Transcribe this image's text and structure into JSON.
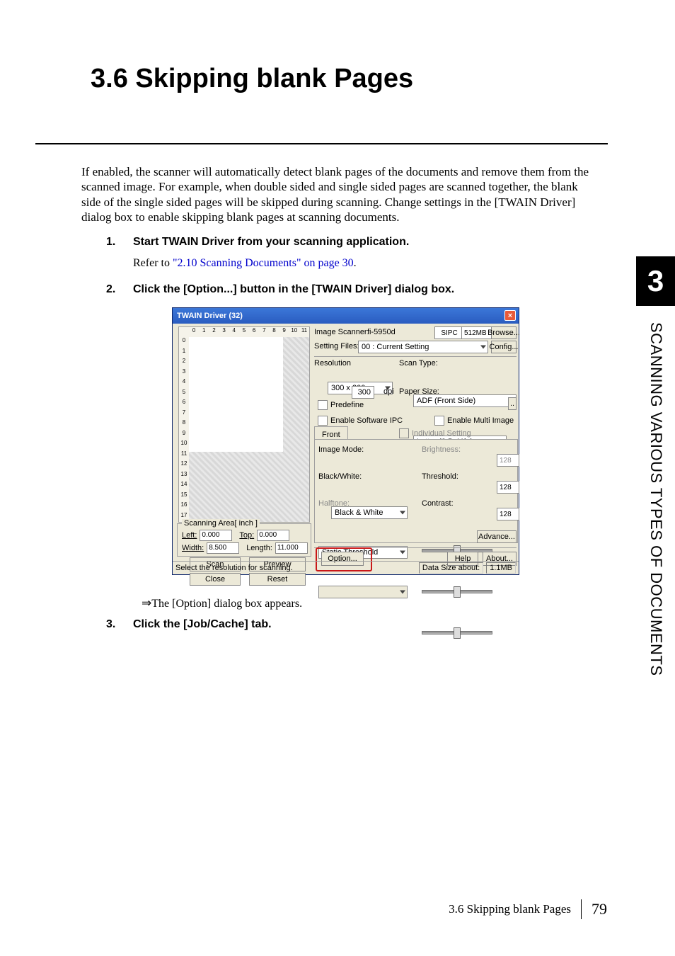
{
  "heading": "3.6  Skipping blank Pages",
  "intro": "If enabled, the scanner will automatically detect blank pages of the documents and remove them from the scanned image. For example, when double sided and single sided pages are scanned together, the blank side of the single sided pages will be skipped during scanning. Change settings in the [TWAIN Driver] dialog box to enable skipping blank pages at scanning documents.",
  "side": {
    "chapter": "3",
    "text": "SCANNING VARIOUS TYPES OF DOCUMENTS"
  },
  "steps": {
    "s1": {
      "num": "1.",
      "text": "Start TWAIN Driver from your scanning application."
    },
    "s2": {
      "num": "2.",
      "text": "Click the [Option...] button in the [TWAIN Driver] dialog box."
    },
    "s3": {
      "num": "3.",
      "text": "Click the [Job/Cache] tab."
    }
  },
  "refer": {
    "prefix": "Refer to ",
    "link": "\"2.10 Scanning Documents\" on page 30",
    "suffix": "."
  },
  "arrow_line": "The [Option] dialog box appears.",
  "dialog": {
    "title": "TWAIN Driver (32)",
    "top": {
      "scanner_lbl": "Image Scanner:",
      "scanner_val": "fi-5950d",
      "sipc": "SIPC",
      "mem": "512MB",
      "browse": "Browse...",
      "setting_lbl": "Setting Files:",
      "setting_val": "00 : Current Setting",
      "config": "Config..."
    },
    "res": {
      "label": "Resolution",
      "value": "300 x 300",
      "dpi_val": "300",
      "dpi_unit": "dpi",
      "predefine": "Predefine"
    },
    "scantype": {
      "label": "Scan Type:",
      "value": "ADF (Front Side)"
    },
    "papersize": {
      "label": "Paper Size:",
      "value": "Letter (8.5x11in)"
    },
    "cb": {
      "softipc": "Enable Software IPC",
      "multi": "Enable Multi Image",
      "indiv": "Individual Setting"
    },
    "tab_front": "Front",
    "img": {
      "mode_lbl": "Image Mode:",
      "mode_val": "Black & White",
      "bw_lbl": "Black/White:",
      "bw_val": "Static Threshold",
      "halftone_lbl": "Halftone:"
    },
    "sliders": {
      "bright_lbl": "Brightness:",
      "bright_val": "128",
      "thresh_lbl": "Threshold:",
      "thresh_val": "128",
      "contrast_lbl": "Contrast:",
      "contrast_val": "128"
    },
    "advance": "Advance...",
    "scanarea": {
      "legend": "Scanning Area[ inch ]",
      "left_lbl": "Left:",
      "left_val": "0.000",
      "top_lbl": "Top:",
      "top_val": "0.000",
      "width_lbl": "Width:",
      "width_val": "8.500",
      "length_lbl": "Length:",
      "length_val": "11.000"
    },
    "btns": {
      "scan": "Scan",
      "preview": "Preview",
      "close": "Close",
      "reset": "Reset",
      "option": "Option...",
      "help": "Help",
      "about": "About..."
    },
    "status": {
      "left": "Select the resolution for scanning.",
      "size_lbl": "Data Size about:",
      "size_val": "1.1MB"
    },
    "ruler_top": [
      "0",
      "1",
      "2",
      "3",
      "4",
      "5",
      "6",
      "7",
      "8",
      "9",
      "10",
      "11"
    ],
    "ruler_left": [
      "0",
      "1",
      "2",
      "3",
      "4",
      "5",
      "6",
      "7",
      "8",
      "9",
      "10",
      "11",
      "12",
      "13",
      "14",
      "15",
      "16",
      "17"
    ]
  },
  "footer": {
    "title": "3.6 Skipping blank Pages",
    "page": "79"
  }
}
